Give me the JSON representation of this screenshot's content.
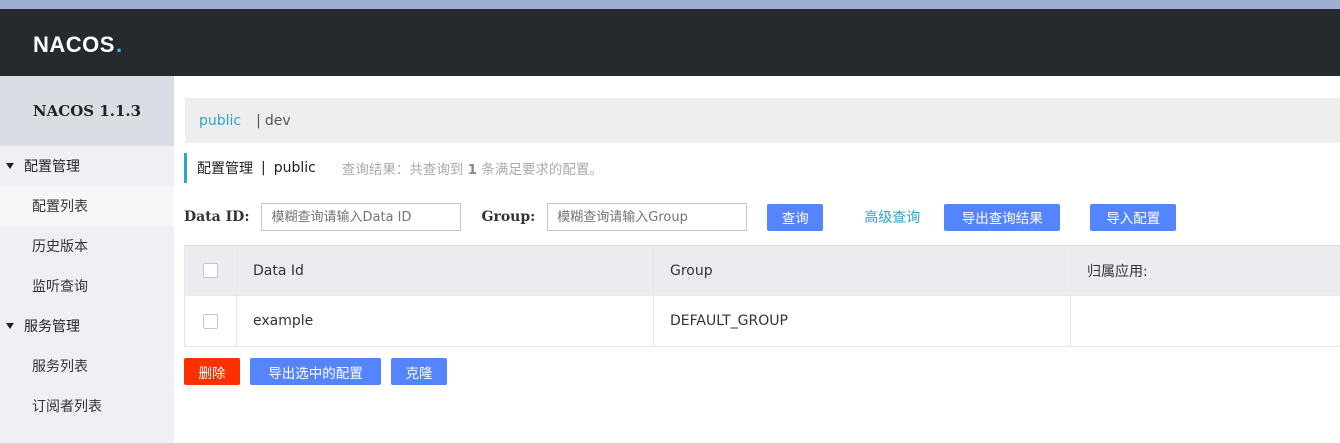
{
  "header": {
    "logo_text": "NACOS",
    "logo_dot": "."
  },
  "sidebar": {
    "version": "NACOS 1.1.3",
    "groups": [
      {
        "label": "配置管理",
        "items": [
          "配置列表",
          "历史版本",
          "监听查询"
        ]
      },
      {
        "label": "服务管理",
        "items": [
          "服务列表",
          "订阅者列表"
        ]
      }
    ]
  },
  "namespace": {
    "active": "public",
    "separator": "|",
    "other": "dev"
  },
  "title": {
    "main": "配置管理",
    "pipe": "|",
    "namespace": "public",
    "result_prefix": "查询结果：共查询到",
    "result_count": "1",
    "result_suffix": "条满足要求的配置。"
  },
  "query": {
    "dataid_label": "Data ID:",
    "dataid_placeholder": "模糊查询请输入Data ID",
    "group_label": "Group:",
    "group_placeholder": "模糊查询请输入Group",
    "search_button": "查询",
    "advanced_link": "高级查询",
    "export_button": "导出查询结果",
    "import_button": "导入配置"
  },
  "table": {
    "columns": [
      "Data Id",
      "Group",
      "归属应用:"
    ],
    "rows": [
      {
        "data_id": "example",
        "group": "DEFAULT_GROUP",
        "app": ""
      }
    ]
  },
  "actions": {
    "delete": "删除",
    "export_selected": "导出选中的配置",
    "clone": "克隆"
  },
  "colors": {
    "accent": "#28a8c6",
    "primary": "#5584ff",
    "danger": "#ff3000",
    "header_bg": "#252a2f"
  }
}
